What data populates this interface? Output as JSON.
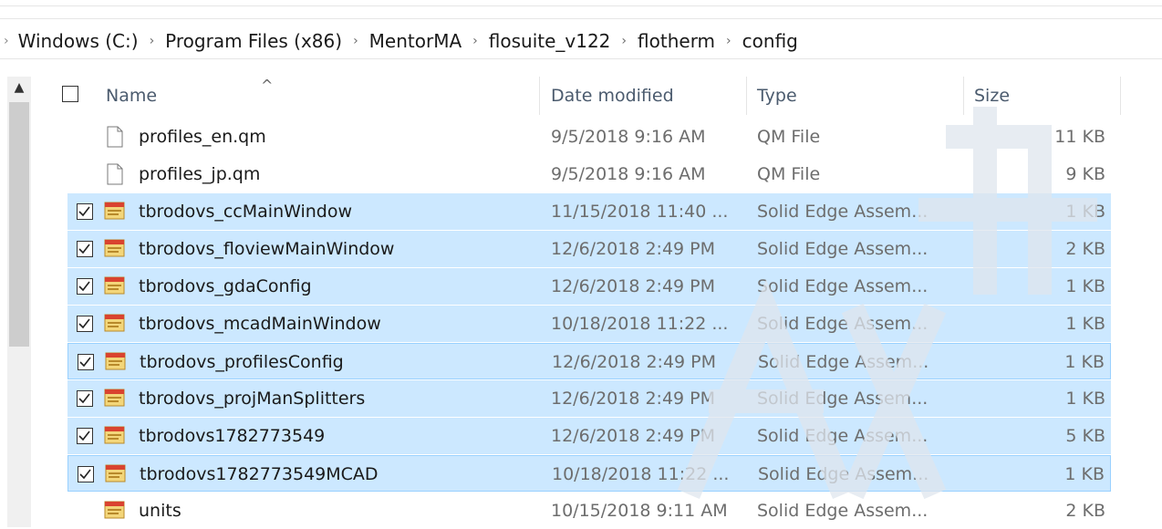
{
  "breadcrumb": {
    "items": [
      "Windows (C:)",
      "Program Files (x86)",
      "MentorMA",
      "flosuite_v122",
      "flotherm",
      "config"
    ],
    "separator": "›"
  },
  "columns": {
    "name": "Name",
    "date": "Date modified",
    "type": "Type",
    "size": "Size"
  },
  "files": [
    {
      "name": "profiles_en.qm",
      "date": "9/5/2018 9:16 AM",
      "type": "QM File",
      "size": "11 KB",
      "selected": false,
      "icon": "blank-file-icon"
    },
    {
      "name": "profiles_jp.qm",
      "date": "9/5/2018 9:16 AM",
      "type": "QM File",
      "size": "9 KB",
      "selected": false,
      "icon": "blank-file-icon"
    },
    {
      "name": "tbrodovs_ccMainWindow",
      "date": "11/15/2018 11:40 ...",
      "type": "Solid Edge Assem...",
      "size": "1 KB",
      "selected": true,
      "icon": "assembly-file-icon"
    },
    {
      "name": "tbrodovs_floviewMainWindow",
      "date": "12/6/2018 2:49 PM",
      "type": "Solid Edge Assem...",
      "size": "2 KB",
      "selected": true,
      "icon": "assembly-file-icon"
    },
    {
      "name": "tbrodovs_gdaConfig",
      "date": "12/6/2018 2:49 PM",
      "type": "Solid Edge Assem...",
      "size": "1 KB",
      "selected": true,
      "icon": "assembly-file-icon"
    },
    {
      "name": "tbrodovs_mcadMainWindow",
      "date": "10/18/2018 11:22 ...",
      "type": "Solid Edge Assem...",
      "size": "1 KB",
      "selected": true,
      "icon": "assembly-file-icon"
    },
    {
      "name": "tbrodovs_profilesConfig",
      "date": "12/6/2018 2:49 PM",
      "type": "Solid Edge Assem...",
      "size": "1 KB",
      "selected": true,
      "focused": true,
      "icon": "assembly-file-icon"
    },
    {
      "name": "tbrodovs_projManSplitters",
      "date": "12/6/2018 2:49 PM",
      "type": "Solid Edge Assem...",
      "size": "1 KB",
      "selected": true,
      "icon": "assembly-file-icon"
    },
    {
      "name": "tbrodovs1782773549",
      "date": "12/6/2018 2:49 PM",
      "type": "Solid Edge Assem...",
      "size": "5 KB",
      "selected": true,
      "icon": "assembly-file-icon"
    },
    {
      "name": "tbrodovs1782773549MCAD",
      "date": "10/18/2018 11:22 ...",
      "type": "Solid Edge Assem...",
      "size": "1 KB",
      "selected": true,
      "focused": true,
      "icon": "assembly-file-icon"
    },
    {
      "name": "units",
      "date": "10/15/2018 9:11 AM",
      "type": "Solid Edge Assem...",
      "size": "2 KB",
      "selected": false,
      "icon": "assembly-file-icon"
    }
  ],
  "colors": {
    "selection": "#cce8ff",
    "selection_border": "#99d1ff",
    "header_text": "#4b5b6e",
    "icon_yellow": "#e8b94a",
    "icon_red": "#d9432f"
  }
}
